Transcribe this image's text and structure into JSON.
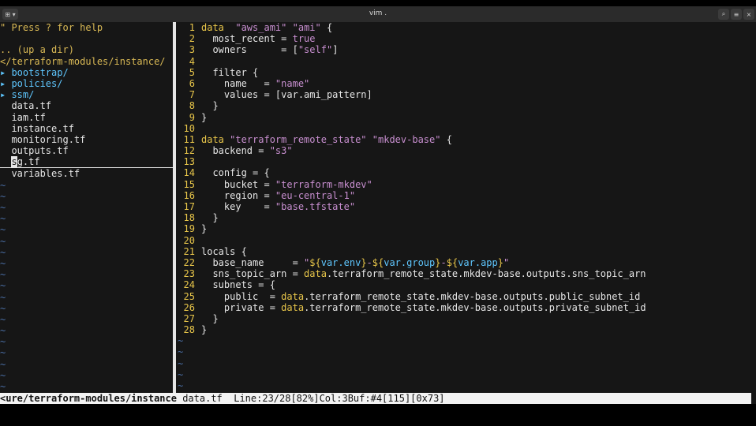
{
  "window": {
    "title": "vim .",
    "left_button_icon": "terminal-menu-icon",
    "right_buttons": [
      "search-icon",
      "hamburger-menu-icon",
      "close-icon"
    ]
  },
  "explorer": {
    "help": "\" Press ? for help",
    "up_dir": ".. (up a dir)",
    "current_dir": "</terraform-modules/instance/",
    "dirs": [
      "bootstrap/",
      "policies/",
      "ssm/"
    ],
    "files": [
      "data.tf",
      "iam.tf",
      "instance.tf",
      "monitoring.tf",
      "outputs.tf",
      "sg.tf",
      "variables.tf"
    ],
    "selected_file": "sg.tf",
    "tilde_count": 19
  },
  "editor": {
    "lines": [
      {
        "n": "1",
        "segs": [
          [
            "kw",
            "data"
          ],
          [
            "",
            "  "
          ],
          [
            "str",
            "\"aws_ami\""
          ],
          [
            "",
            ""
          ],
          [
            "str",
            " \"ami\""
          ],
          [
            "",
            " {"
          ]
        ]
      },
      {
        "n": "2",
        "segs": [
          [
            "",
            "  most_recent = "
          ],
          [
            "bool",
            "true"
          ]
        ]
      },
      {
        "n": "3",
        "segs": [
          [
            "",
            "  owners      = ["
          ],
          [
            "str",
            "\"self\""
          ],
          [
            "",
            "]"
          ]
        ]
      },
      {
        "n": "4",
        "segs": [
          [
            "",
            ""
          ]
        ]
      },
      {
        "n": "5",
        "segs": [
          [
            "",
            "  filter {"
          ]
        ]
      },
      {
        "n": "6",
        "segs": [
          [
            "",
            "    name   = "
          ],
          [
            "str",
            "\"name\""
          ]
        ]
      },
      {
        "n": "7",
        "segs": [
          [
            "",
            "    values = [var.ami_pattern]"
          ]
        ]
      },
      {
        "n": "8",
        "segs": [
          [
            "",
            "  }"
          ]
        ]
      },
      {
        "n": "9",
        "segs": [
          [
            "",
            "}"
          ]
        ]
      },
      {
        "n": "10",
        "segs": [
          [
            "",
            ""
          ]
        ]
      },
      {
        "n": "11",
        "segs": [
          [
            "kw",
            "data"
          ],
          [
            "",
            " "
          ],
          [
            "str",
            "\"terraform_remote_state\""
          ],
          [
            "",
            " "
          ],
          [
            "str",
            "\"mkdev-base\""
          ],
          [
            "",
            " {"
          ]
        ]
      },
      {
        "n": "12",
        "segs": [
          [
            "",
            "  backend = "
          ],
          [
            "str",
            "\"s3\""
          ]
        ]
      },
      {
        "n": "13",
        "segs": [
          [
            "",
            ""
          ]
        ]
      },
      {
        "n": "14",
        "segs": [
          [
            "",
            "  config = {"
          ]
        ]
      },
      {
        "n": "15",
        "segs": [
          [
            "",
            "    bucket = "
          ],
          [
            "str",
            "\"terraform-mkdev\""
          ]
        ]
      },
      {
        "n": "16",
        "segs": [
          [
            "",
            "    region = "
          ],
          [
            "str",
            "\"eu-central-1\""
          ]
        ]
      },
      {
        "n": "17",
        "segs": [
          [
            "",
            "    key    = "
          ],
          [
            "str",
            "\"base.tfstate\""
          ]
        ]
      },
      {
        "n": "18",
        "segs": [
          [
            "",
            "  }"
          ]
        ]
      },
      {
        "n": "19",
        "segs": [
          [
            "",
            "}"
          ]
        ]
      },
      {
        "n": "20",
        "segs": [
          [
            "",
            ""
          ]
        ]
      },
      {
        "n": "21",
        "segs": [
          [
            "",
            "locals {"
          ]
        ]
      },
      {
        "n": "22",
        "segs": [
          [
            "",
            "  base_name     = "
          ],
          [
            "str",
            "\""
          ],
          [
            "kw",
            "${"
          ],
          [
            "var",
            "var.env"
          ],
          [
            "kw",
            "}"
          ],
          [
            "str",
            "-"
          ],
          [
            "kw",
            "${"
          ],
          [
            "var",
            "var.group"
          ],
          [
            "kw",
            "}"
          ],
          [
            "str",
            "-"
          ],
          [
            "kw",
            "${"
          ],
          [
            "var",
            "var.app"
          ],
          [
            "kw",
            "}"
          ],
          [
            "str",
            "\""
          ]
        ]
      },
      {
        "n": "23",
        "segs": [
          [
            "",
            "  sns_topic_arn = "
          ],
          [
            "kw",
            "data"
          ],
          [
            "",
            ".terraform_remote_state.mkdev-base.outputs.sns_topic_arn"
          ]
        ]
      },
      {
        "n": "24",
        "segs": [
          [
            "",
            "  subnets = {"
          ]
        ]
      },
      {
        "n": "25",
        "segs": [
          [
            "",
            "    public  = "
          ],
          [
            "kw",
            "data"
          ],
          [
            "",
            ".terraform_remote_state.mkdev-base.outputs.public_subnet_id"
          ]
        ]
      },
      {
        "n": "26",
        "segs": [
          [
            "",
            "    private = "
          ],
          [
            "kw",
            "data"
          ],
          [
            "",
            ".terraform_remote_state.mkdev-base.outputs.private_subnet_id"
          ]
        ]
      },
      {
        "n": "27",
        "segs": [
          [
            "",
            "  }"
          ]
        ]
      },
      {
        "n": "28",
        "segs": [
          [
            "",
            "}"
          ]
        ]
      }
    ],
    "tilde_count": 5
  },
  "statusbar": {
    "path": "<ure/terraform-modules/instance",
    "info": " data.tf  Line:23/28[82%]Col:3Buf:#4[115][0x73]"
  }
}
